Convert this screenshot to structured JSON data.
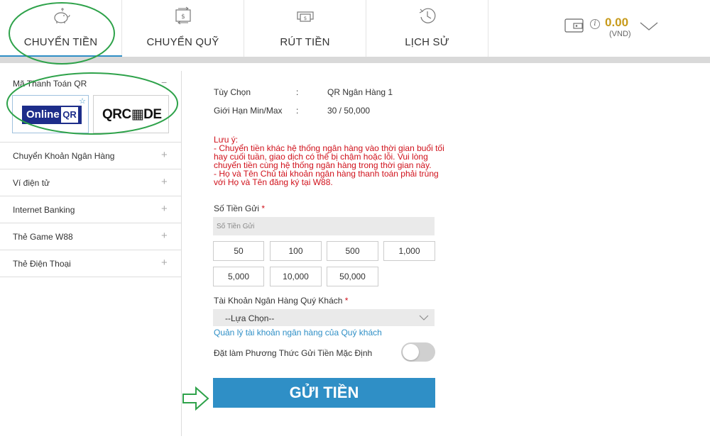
{
  "colors": {
    "accent": "#2f8fc6",
    "warning_text": "#d0111b",
    "balance": "#c79a1a",
    "annotation": "#2ea24a"
  },
  "nav": {
    "tabs": [
      {
        "label": "CHUYỂN TIỀN",
        "icon": "piggy-bank-icon",
        "active": true
      },
      {
        "label": "CHUYỂN QUỸ",
        "icon": "transfer-money-icon",
        "active": false
      },
      {
        "label": "RÚT TIỀN",
        "icon": "withdraw-money-icon",
        "active": false
      },
      {
        "label": "LỊCH SỬ",
        "icon": "history-clock-icon",
        "active": false
      }
    ],
    "wallet": {
      "icon": "wallet-icon",
      "balance": "0.00",
      "currency": "(VND)",
      "info_icon": "i"
    }
  },
  "sidebar": {
    "qr_section": {
      "title": "Mã Thanh Toán QR",
      "collapse_symbol": "−",
      "methods": [
        {
          "logo_text": "Online",
          "logo_box": "QR",
          "selected": true
        },
        {
          "logo_text": "QRC▦DE",
          "selected": false
        }
      ]
    },
    "items": [
      {
        "label": "Chuyển Khoản Ngân Hàng",
        "symbol": "+"
      },
      {
        "label": "Ví điện tử",
        "symbol": "+"
      },
      {
        "label": "Internet Banking",
        "symbol": "+"
      },
      {
        "label": "Thẻ Game W88",
        "symbol": "+"
      },
      {
        "label": "Thẻ Điện Thoại",
        "symbol": "+"
      }
    ]
  },
  "form": {
    "option_label": "Tùy Chọn",
    "option_colon": ":",
    "option_value": "QR Ngân Hàng 1",
    "limit_label": "Giới Hạn Min/Max",
    "limit_colon": ":",
    "limit_value": "30 / 50,000",
    "note_lines": [
      "Lưu ý:",
      "- Chuyển tiền khác hệ thống ngân hàng vào thời gian buổi tối",
      "hay cuối tuần, giao dịch có thể bị chậm hoặc lỗi. Vui lòng",
      "chuyển tiền cùng hệ thống ngân hàng trong thời gian này.",
      "- Họ và Tên Chủ tài khoản ngân hàng thanh toán phải trùng",
      "với Họ và Tên đăng ký tại W88."
    ],
    "amount_label": "Số Tiền Gửi",
    "required_mark": "*",
    "amount_placeholder": "Số Tiền Gửi",
    "quick_amounts": [
      "50",
      "100",
      "500",
      "1,000",
      "5,000",
      "10,000",
      "50,000"
    ],
    "bank_account_label": "Tài Khoản Ngân Hàng Quý Khách",
    "bank_select_value": "--Lựa Chọn--",
    "manage_link": "Quản lý tài khoản ngân hàng của Quý khách",
    "default_toggle_label": "Đặt làm Phương Thức Gửi Tiền Mặc Định",
    "default_toggle_on": false,
    "submit_label": "GỬI TIỀN"
  }
}
